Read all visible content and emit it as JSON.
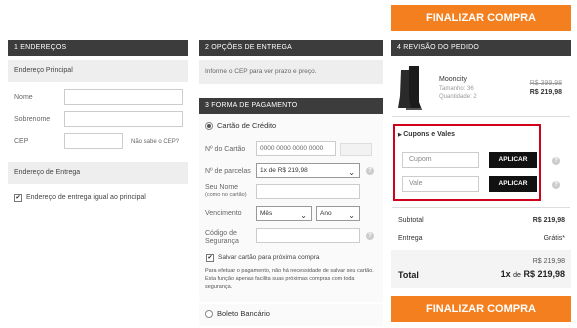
{
  "actions": {
    "finalize_label": "FINALIZAR COMPRA"
  },
  "address": {
    "header": "1 ENDEREÇOS",
    "main_title": "Endereço Principal",
    "name_label": "Nome",
    "surname_label": "Sobrenome",
    "cep_label": "CEP",
    "cep_help": "Não sabe o CEP?",
    "delivery_title": "Endereço de Entrega",
    "same_address_label": "Endereço de entrega igual ao principal",
    "same_address_checked": true
  },
  "shipping": {
    "header": "2 OPÇÕES DE ENTREGA",
    "info": "Informe o CEP para ver prazo e preço."
  },
  "payment": {
    "header": "3 FORMA DE PAGAMENTO",
    "credit_label": "Cartão de Crédito",
    "card_number_label": "Nº do Cartão",
    "card_number_placeholder": "0000 0000 0000 0000",
    "installments_label": "Nº de parcelas",
    "installments_value": "1x de R$ 219,98",
    "name_label": "Seu Nome",
    "name_sublabel": "(como no cartão)",
    "expiry_label": "Vencimento",
    "month_value": "Mês",
    "year_value": "Ano",
    "security_label_1": "Código de",
    "security_label_2": "Segurança",
    "save_card_label": "Salvar cartão para próxima compra",
    "save_card_checked": true,
    "save_note": "Para efetuar o pagamento, não há necessidade de salvar seu cartão. Esta função apenas facilita suas próximas compras com toda segurança.",
    "boleto_label": "Boleto Bancário",
    "help_glyph": "?"
  },
  "review": {
    "header": "4 REVISÃO DO PEDIDO",
    "product": {
      "name": "Mooncity",
      "size": "Tamanho: 36",
      "quantity": "Quantidade: 2",
      "old_price": "R$ 399,98",
      "price": "R$ 219,98"
    },
    "coupons_title": "Cupons e Vales",
    "coupon_placeholder": "Cupom",
    "voucher_placeholder": "Vale",
    "apply_label": "APLICAR",
    "subtotal_label": "Subtotal",
    "subtotal_value": "R$ 219,98",
    "delivery_label": "Entrega",
    "delivery_value": "Grátis*",
    "total_small": "R$ 219,98",
    "total_label": "Total",
    "total_prefix": "1x",
    "total_de": "de",
    "total_value": "R$ 219,98"
  },
  "colors": {
    "accent": "#f47f1f",
    "header_bg": "#3c3c3c",
    "highlight_border": "#d0021b"
  }
}
